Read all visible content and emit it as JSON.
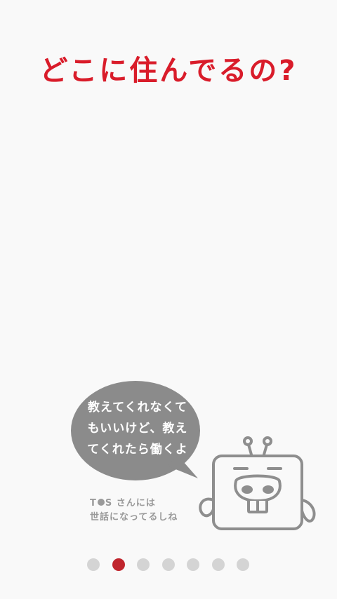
{
  "header": {
    "title": "どこに住んでるの?"
  },
  "speech_bubble": {
    "lines": [
      "教えてくれなくて",
      "もいいけど、教え",
      "てくれたら働くよ"
    ],
    "color": "#8b8b8b"
  },
  "caption": {
    "line1_prefix": "T",
    "line1_suffix": "S さんには",
    "line2": "世話になってるしね"
  },
  "mascot": {
    "icon": "tos-mascot-icon"
  },
  "pagination": {
    "count": 7,
    "active_index": 1,
    "colors": {
      "active": "#c0252d",
      "inactive": "#d4d4d4"
    }
  },
  "colors": {
    "accent": "#d91c2a",
    "background": "#f9f9f9",
    "mascot_stroke": "#8e8e8e"
  }
}
